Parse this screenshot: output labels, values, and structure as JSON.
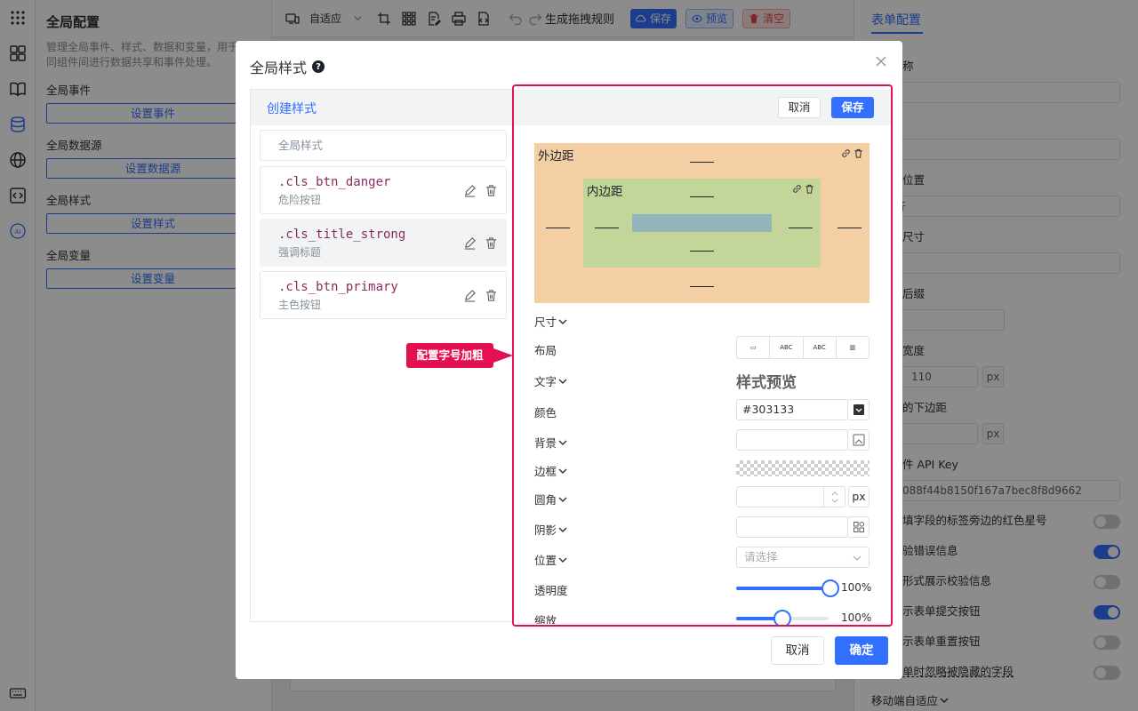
{
  "global_panel": {
    "title": "全局配置",
    "description_line1": "管理全局事件、样式、数据和变量，用于",
    "description_line2": "同组件间进行数据共享和事件处理。",
    "sections": [
      {
        "label": "全局事件",
        "button": "设置事件"
      },
      {
        "label": "全局数据源",
        "button": "设置数据源"
      },
      {
        "label": "全局样式",
        "button": "设置样式"
      },
      {
        "label": "全局变量",
        "button": "设置变量"
      }
    ]
  },
  "toolbar": {
    "device_select": "自适应",
    "generate_rules": "生成拖拽规则",
    "save": "保存",
    "preview": "预览",
    "clear": "清空"
  },
  "right_panel": {
    "tab": "表单配置",
    "fragments": {
      "name": "称",
      "label_position": "位置",
      "label_position_value": "齐",
      "size": "尺寸",
      "suffix": "后缀",
      "width": "宽度",
      "width_value": "110",
      "width_unit": "px",
      "bottom_margin": "的下边距",
      "bottom_unit": "px",
      "api_key_label": "件 API Key",
      "api_key_value": "088f44b8150f167a7bec8f8d9662",
      "toggle1": "填字段的标签旁边的红色星号",
      "toggle2": "验错误信息",
      "toggle3": "形式展示校验信息",
      "toggle4": "示表单提交按钮",
      "toggle5": "示表单重置按钮",
      "toggle6": "单时忽略被隐藏的字段",
      "mobile": "移动端自适应"
    },
    "toggles": [
      false,
      true,
      false,
      true,
      false,
      false
    ]
  },
  "modal": {
    "title": "全局样式",
    "create_link": "创建样式",
    "global_style_row": "全局样式",
    "classes": [
      {
        "name": ".cls_btn_danger",
        "desc": "危险按钮"
      },
      {
        "name": ".cls_title_strong",
        "desc": "强调标题"
      },
      {
        "name": ".cls_btn_primary",
        "desc": "主色按钮"
      }
    ],
    "callout": "配置字号加粗",
    "editor": {
      "cancel": "取消",
      "save": "保存",
      "margin_label": "外边距",
      "padding_label": "内边距",
      "props": {
        "size": "尺寸",
        "layout": "布局",
        "text": "文字",
        "color": "颜色",
        "background": "背景",
        "border": "边框",
        "radius": "圆角",
        "shadow": "阴影",
        "position": "位置",
        "opacity": "透明度",
        "scale": "缩放"
      },
      "layout_options": [
        "▭",
        "ABC",
        "ABC",
        "▥"
      ],
      "preview_text": "样式预览",
      "color_value": "#303133",
      "radius_unit": "px",
      "position_placeholder": "请选择",
      "opacity_percent": 100,
      "opacity_label": "100%",
      "scale_percent": 100,
      "scale_label": "100%"
    },
    "footer": {
      "cancel": "取消",
      "ok": "确定"
    }
  }
}
